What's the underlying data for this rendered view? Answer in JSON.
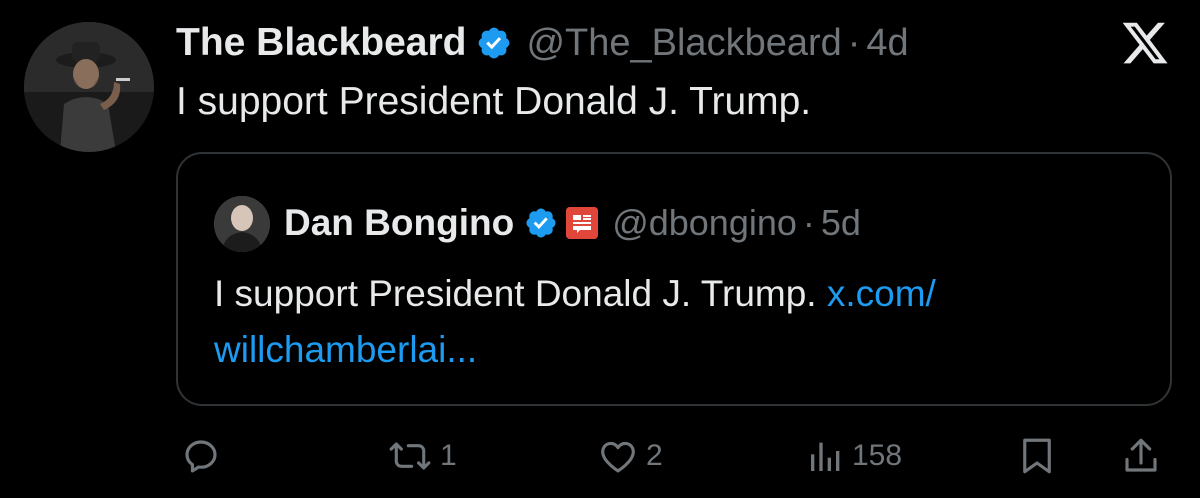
{
  "tweet": {
    "display_name": "The Blackbeard",
    "handle": "@The_Blackbeard",
    "separator": "·",
    "time": "4d",
    "text": "I support President Donald J. Trump."
  },
  "quote": {
    "display_name": "Dan Bongino",
    "handle": "@dbongino",
    "separator": "·",
    "time": "5d",
    "text": "I support President Donald J. Trump. ",
    "link_line1": "x.com/",
    "link_line2": "willchamberlai..."
  },
  "actions": {
    "reply_count": "",
    "retweet_count": "1",
    "like_count": "2",
    "views_count": "158"
  },
  "colors": {
    "background": "#000000",
    "text": "#e7e9ea",
    "muted": "#71767b",
    "link": "#1d9bf0",
    "verified": "#1d9bf0",
    "border": "#2f3336",
    "badge": "#e0463a"
  },
  "icons": {
    "brand": "x-logo-icon",
    "verified": "verified-badge-icon",
    "affiliation": "affiliation-badge-icon",
    "reply": "reply-icon",
    "retweet": "retweet-icon",
    "like": "heart-icon",
    "views": "views-icon",
    "bookmark": "bookmark-icon",
    "share": "share-icon"
  }
}
